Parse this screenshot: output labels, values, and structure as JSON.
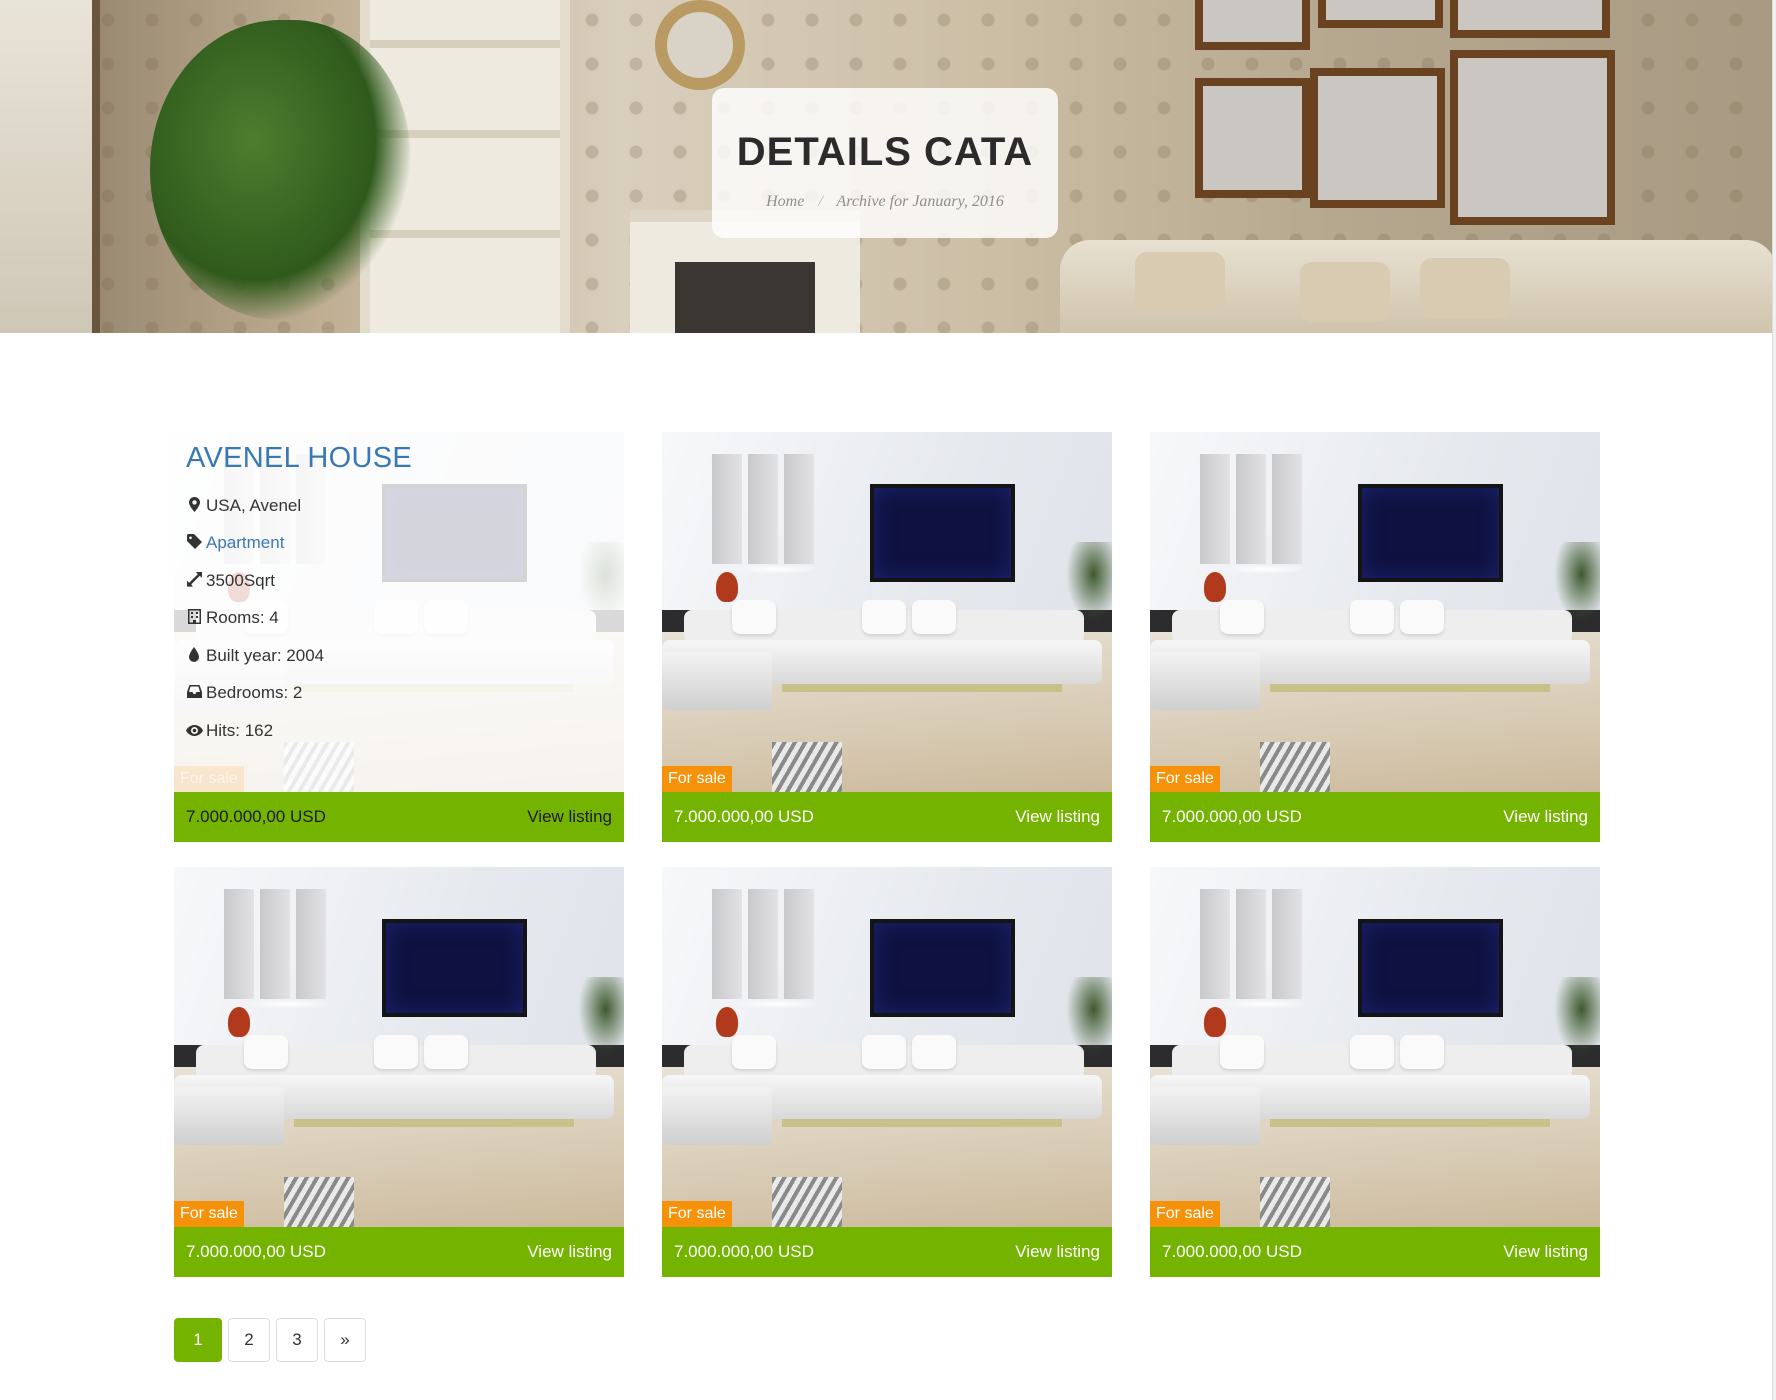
{
  "hero": {
    "title": "DETAILS CATA",
    "breadcrumb": {
      "home": "Home",
      "separator": "/",
      "current": "Archive for January, 2016"
    }
  },
  "featured": {
    "title": "AVENEL HOUSE",
    "location": "USA, Avenel",
    "type": "Apartment",
    "area": "3500Sqrt",
    "rooms": "Rooms: 4",
    "built_year": "Built year: 2004",
    "bedrooms": "Bedrooms: 2",
    "hits": "Hits: 162",
    "icons": [
      "map-marker-icon",
      "tag-icon",
      "resize-icon",
      "building-icon",
      "tint-icon",
      "inbox-icon",
      "eye-icon"
    ]
  },
  "listings": [
    {
      "badge": "For sale",
      "price": "7.000.000,00 USD",
      "link": "View listing"
    },
    {
      "badge": "For sale",
      "price": "7.000.000,00 USD",
      "link": "View listing"
    },
    {
      "badge": "For sale",
      "price": "7.000.000,00 USD",
      "link": "View listing"
    },
    {
      "badge": "For sale",
      "price": "7.000.000,00 USD",
      "link": "View listing"
    },
    {
      "badge": "For sale",
      "price": "7.000.000,00 USD",
      "link": "View listing"
    },
    {
      "badge": "For sale",
      "price": "7.000.000,00 USD",
      "link": "View listing"
    }
  ],
  "pagination": {
    "pages": [
      "1",
      "2",
      "3"
    ],
    "next": "»",
    "current": "1"
  },
  "colors": {
    "accent_green": "#74b400",
    "badge_orange": "#f5920a",
    "link_blue": "#3a78b5"
  }
}
